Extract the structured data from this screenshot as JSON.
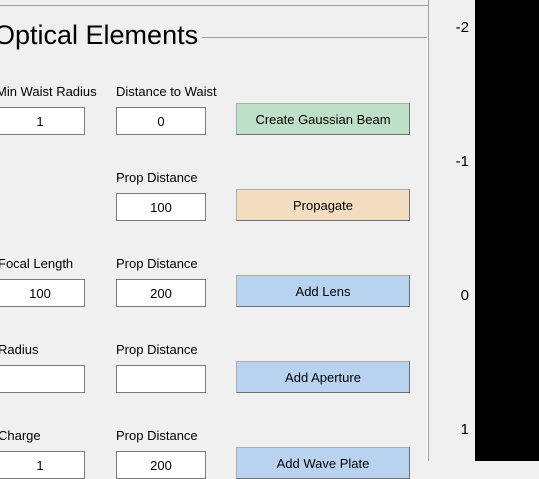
{
  "panel": {
    "title": "Optical Elements"
  },
  "rows": {
    "gaussian": {
      "label1": "Min Waist Radius",
      "value1": "1",
      "label2": "Distance to Waist",
      "value2": "0",
      "button": "Create Gaussian Beam"
    },
    "propagate": {
      "label2": "Prop Distance",
      "value2": "100",
      "button": "Propagate"
    },
    "lens": {
      "label1": "Focal Length",
      "value1": "100",
      "label2": "Prop Distance",
      "value2": "200",
      "button": "Add Lens"
    },
    "aperture": {
      "label1": "Radius",
      "value1": "",
      "label2": "Prop Distance",
      "value2": "",
      "button": "Add Aperture"
    },
    "waveplate": {
      "label1": "Charge",
      "value1": "1",
      "label2": "Prop Distance",
      "value2": "200",
      "button": "Add Wave Plate"
    }
  },
  "axis": {
    "ticks": [
      "-2",
      "-1",
      "0",
      "1"
    ]
  },
  "colors": {
    "create_button": "#bfe0c8",
    "propagate_button": "#f2ddc0",
    "add_button": "#b8d3f0",
    "plot_background": "#000000"
  }
}
